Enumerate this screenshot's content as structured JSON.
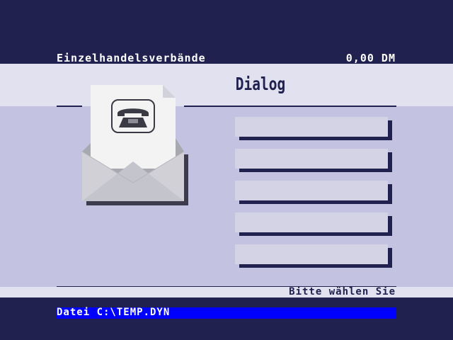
{
  "header": {
    "category": "Einzelhandelsverbände",
    "amount": "0,00 DM"
  },
  "dialog": {
    "title": "Dialog",
    "icon": "telephone-envelope-icon",
    "buttons": [
      "",
      "",
      "",
      "",
      ""
    ]
  },
  "status": {
    "hint": "Bitte wählen Sie",
    "file": "Datei C:\\TEMP.DYN"
  },
  "colors": {
    "background": "#20214f",
    "light_band": "#e2e1ef",
    "panel": "#c3c3e1",
    "button": "#d4d3e6",
    "file_bar": "#0000ff"
  }
}
